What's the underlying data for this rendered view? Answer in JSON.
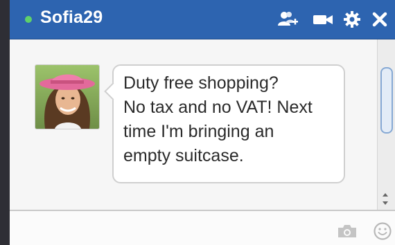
{
  "chat": {
    "contact_name": "Sofia29",
    "status": "online",
    "status_color": "#5fd16a",
    "header_color": "#2d64b0"
  },
  "header_icons": [
    "add-friend-icon",
    "video-call-icon",
    "gear-icon",
    "close-icon"
  ],
  "message": {
    "text": "Duty free shopping?\nNo tax and no VAT! Next\ntime I'm bringing an\nempty suitcase."
  },
  "composer_icons": [
    "camera-icon",
    "smiley-icon"
  ]
}
